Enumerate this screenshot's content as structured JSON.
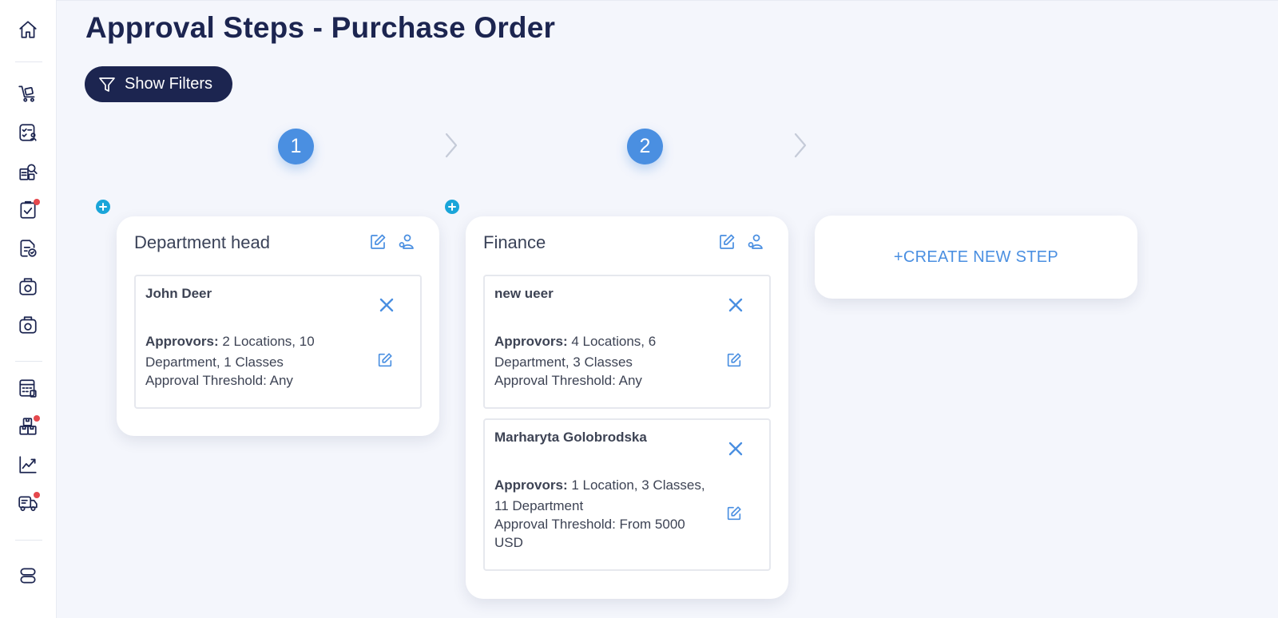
{
  "page": {
    "title": "Approval Steps - Purchase Order"
  },
  "toolbar": {
    "show_filters_label": "Show Filters"
  },
  "sidebar": {
    "items": [
      {
        "icon": "home-icon",
        "badge": false
      },
      {
        "icon": "cart-icon",
        "badge": false
      },
      {
        "icon": "checklist-user-icon",
        "badge": false
      },
      {
        "icon": "search-docs-icon",
        "badge": false
      },
      {
        "icon": "clipboard-check-icon",
        "badge": true
      },
      {
        "icon": "document-check-icon",
        "badge": false
      },
      {
        "icon": "camera-box-icon",
        "badge": false
      },
      {
        "icon": "camera-box-icon",
        "badge": false
      },
      {
        "icon": "calculator-icon",
        "badge": false
      },
      {
        "icon": "boxes-icon",
        "badge": true
      },
      {
        "icon": "chart-line-icon",
        "badge": false
      },
      {
        "icon": "truck-icon",
        "badge": true
      },
      {
        "icon": "server-toggle-icon",
        "badge": false
      }
    ]
  },
  "steps": [
    {
      "number": "1",
      "title": "Department head",
      "approvers": [
        {
          "name": "John Deer",
          "approvers_label": "Approvors:",
          "approvers_value_1": " 2 Locations, 10",
          "approvers_value_2": "Department, 1 Classes",
          "threshold": "Approval Threshold: Any"
        }
      ]
    },
    {
      "number": "2",
      "title": "Finance",
      "approvers": [
        {
          "name": "new ueer",
          "approvers_label": "Approvors:",
          "approvers_value_1": " 4 Locations, 6",
          "approvers_value_2": "Department, 3 Classes",
          "threshold": "Approval Threshold: Any"
        },
        {
          "name": "Marharyta Golobrodska",
          "approvers_label": "Approvors:",
          "approvers_value_1": " 1 Location, 3 Classes,",
          "approvers_value_2": "11 Department",
          "threshold": "Approval Threshold: From 5000",
          "threshold_2": "USD"
        }
      ]
    }
  ],
  "create_step_label": "+CREATE NEW STEP",
  "colors": {
    "navy": "#1c2550",
    "accent_blue": "#4a8fe1",
    "plus_cyan": "#1aa5d9",
    "badge_red": "#e5484d",
    "background": "#f4f6fc"
  }
}
